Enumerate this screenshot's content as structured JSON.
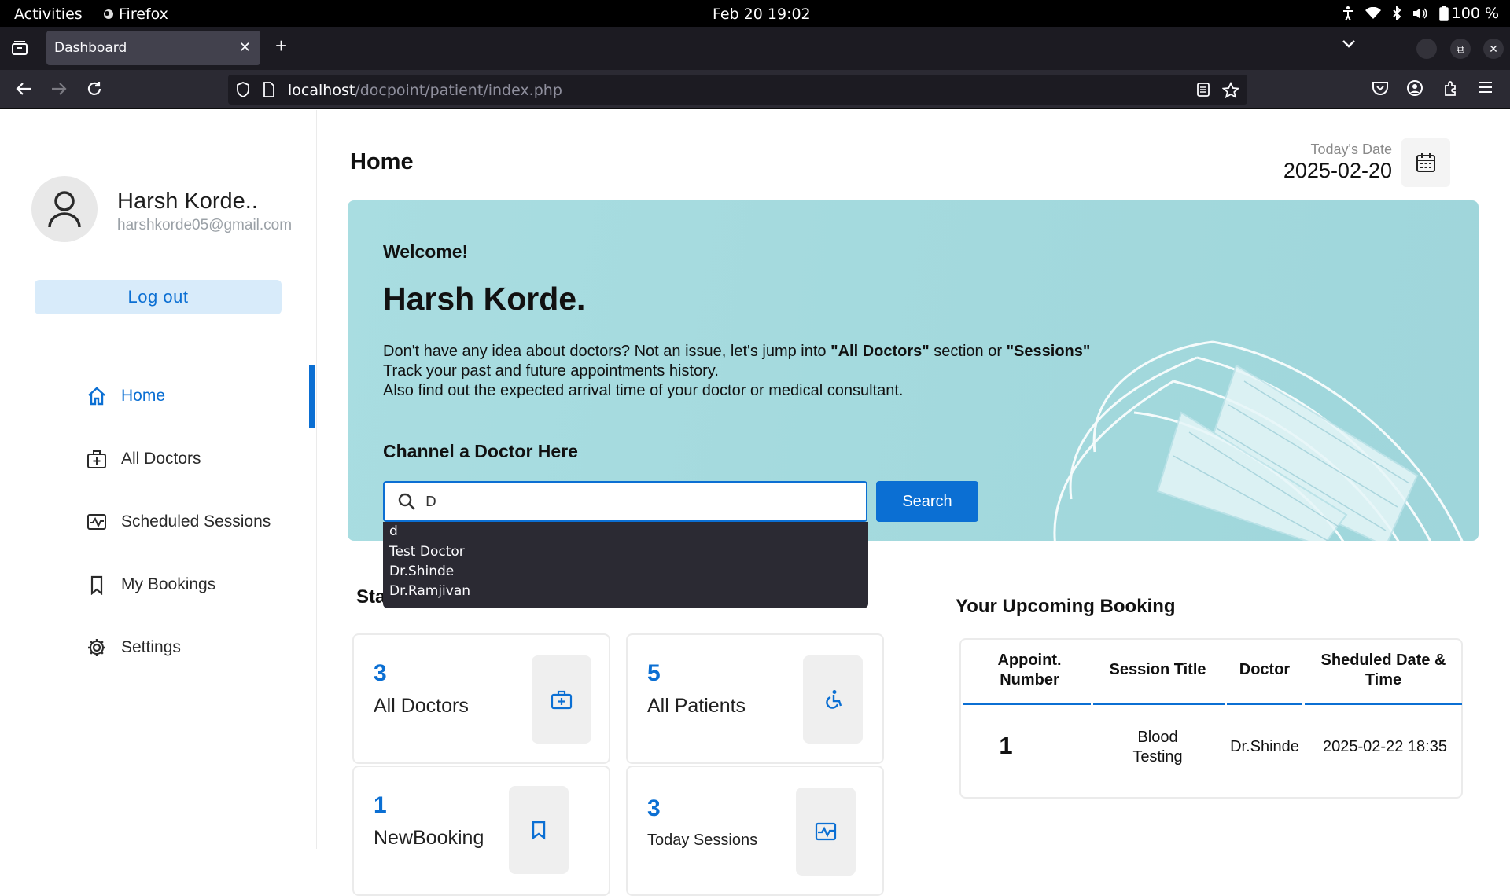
{
  "os": {
    "activities": "Activities",
    "app_name": "Firefox",
    "clock": "Feb 20  19:02",
    "battery": "100 %"
  },
  "browser": {
    "tab_title": "Dashboard",
    "url_host": "localhost",
    "url_path": "/docpoint/patient/index.php"
  },
  "sidebar": {
    "user_name": "Harsh Korde..",
    "user_email": "harshkorde05@gmail.com",
    "logout_label": "Log out",
    "items": [
      {
        "label": "Home",
        "icon": "home-icon",
        "active": true
      },
      {
        "label": "All Doctors",
        "icon": "doctor-bag-icon",
        "active": false
      },
      {
        "label": "Scheduled Sessions",
        "icon": "sessions-icon",
        "active": false
      },
      {
        "label": "My Bookings",
        "icon": "bookmark-icon",
        "active": false
      },
      {
        "label": "Settings",
        "icon": "gear-icon",
        "active": false
      }
    ]
  },
  "header": {
    "title": "Home",
    "date_label": "Today's Date",
    "date_value": "2025-02-20"
  },
  "banner": {
    "welcome": "Welcome!",
    "name": "Harsh Korde.",
    "line1_pre": "Don't have any idea about doctors? Not an issue, let's jump into ",
    "line1_b1": "\"All Doctors\"",
    "line1_mid": " section or ",
    "line1_b2": "\"Sessions\"",
    "line2": "Track your past and future appointments history.",
    "line3": "Also find out the expected arrival time of your doctor or medical consultant.",
    "channel_title": "Channel a Doctor Here",
    "search_value": "D",
    "search_button": "Search",
    "suggestions": [
      "d",
      "Test Doctor",
      "Dr.Shinde",
      "Dr.Ramjivan"
    ]
  },
  "status": {
    "title": "Sta",
    "cards": [
      {
        "value": "3",
        "label": "All Doctors",
        "icon": "doctor-bag-icon"
      },
      {
        "value": "5",
        "label": "All Patients",
        "icon": "wheelchair-icon"
      },
      {
        "value": "1",
        "label": "NewBooking",
        "icon": "bookmark-icon"
      },
      {
        "value": "3",
        "label": "Today Sessions",
        "icon": "sessions-icon"
      }
    ]
  },
  "upcoming": {
    "title": "Your Upcoming Booking",
    "columns": [
      "Appoint. Number",
      "Session Title",
      "Doctor",
      "Sheduled Date & Time"
    ],
    "rows": [
      {
        "number": "1",
        "session": "Blood Testing",
        "doctor": "Dr.Shinde",
        "datetime": "2025-02-22 18:35"
      }
    ]
  },
  "colors": {
    "accent": "#0b6fd3",
    "banner": "#a6dbdf"
  }
}
